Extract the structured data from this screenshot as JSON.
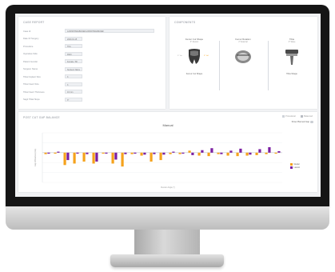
{
  "case_report": {
    "title": "CASE REPORT",
    "rows": [
      {
        "label": "Case Id",
        "value": "1234567890ABCDEF1234567890ABCDEF"
      },
      {
        "label": "Date Of Surgery",
        "value": "2020-01-15"
      },
      {
        "label": "Procedure",
        "value": "TKA"
      },
      {
        "label": "Operative Side",
        "value": "Right"
      },
      {
        "label": "Patient Gender",
        "value": "Female / 68"
      },
      {
        "label": "Surgeon Name",
        "value": "Surgeon Name"
      },
      {
        "label": "Tibial Implant Size",
        "value": "3"
      },
      {
        "label": "Tibial Insert Size",
        "value": "3"
      },
      {
        "label": "Tibial Insert Thickness",
        "value": "10 mm"
      },
      {
        "label": "Sagit Tibial Slope",
        "value": "3°"
      }
    ]
  },
  "components": {
    "title": "COMPONENTS",
    "items": [
      {
        "name": "Femur Cut Shape",
        "sub": "3° Flexion",
        "left": "3° Var",
        "right": "3° Val",
        "foot": "Femur Cut Shape"
      },
      {
        "name": "Femur Rotation",
        "sub": "2° External",
        "left": "",
        "right": "",
        "foot": ""
      },
      {
        "name": "Tibia",
        "sub": "3° Slope",
        "left": "",
        "right": "",
        "foot": "Tibia Shape"
      }
    ]
  },
  "chart": {
    "panel_title": "POST CUT GAP BALANCE",
    "heading": "Manual",
    "view_label": "Show Planned Gap",
    "y_axis_label": "Gap Difference (mm)",
    "x_axis_label": "Flexion Angle (°)",
    "legend_top": [
      {
        "label": "Procedural",
        "color": "#cfd3d9"
      },
      {
        "label": "Balanced",
        "color": "#b8bcc3"
      }
    ],
    "legend_side": [
      {
        "label": "Medial",
        "color": "#f5a21c"
      },
      {
        "label": "Lateral",
        "color": "#7a1fa2"
      }
    ]
  },
  "colors": {
    "medial": "#f5a21c",
    "lateral": "#7a1fa2",
    "baseline": "#c4c8ce"
  },
  "chart_data": {
    "type": "bar",
    "title": "Manual",
    "xlabel": "Flexion Angle (°)",
    "ylabel": "Gap Difference (mm)",
    "ylim": [
      -6,
      4
    ],
    "categories": [
      "1",
      "2",
      "3",
      "4",
      "5",
      "6",
      "7",
      "8",
      "9",
      "10",
      "11",
      "12",
      "13",
      "14",
      "15",
      "16",
      "17",
      "18",
      "19",
      "20",
      "21",
      "22",
      "23",
      "24",
      "25"
    ],
    "series": [
      {
        "name": "Medial",
        "values": [
          -0.3,
          -0.2,
          -2.5,
          -2.2,
          -1.8,
          -2.2,
          -0.2,
          -2.2,
          -2.8,
          -0.3,
          -0.6,
          -1.8,
          -1.5,
          -0.3,
          -0.3,
          0.4,
          -0.6,
          -0.7,
          -0.3,
          -0.6,
          -0.7,
          -0.6,
          -0.5,
          -0.3,
          -0.2
        ]
      },
      {
        "name": "Lateral",
        "values": [
          -0.2,
          0.2,
          -1.5,
          -0.2,
          -0.3,
          -1.8,
          -0.2,
          -1.4,
          -0.3,
          -0.2,
          -0.4,
          -0.3,
          -0.4,
          0.2,
          -0.2,
          -0.5,
          0.5,
          0.9,
          -0.3,
          0.4,
          0.8,
          -0.4,
          0.7,
          1.1,
          0.3
        ]
      }
    ]
  }
}
